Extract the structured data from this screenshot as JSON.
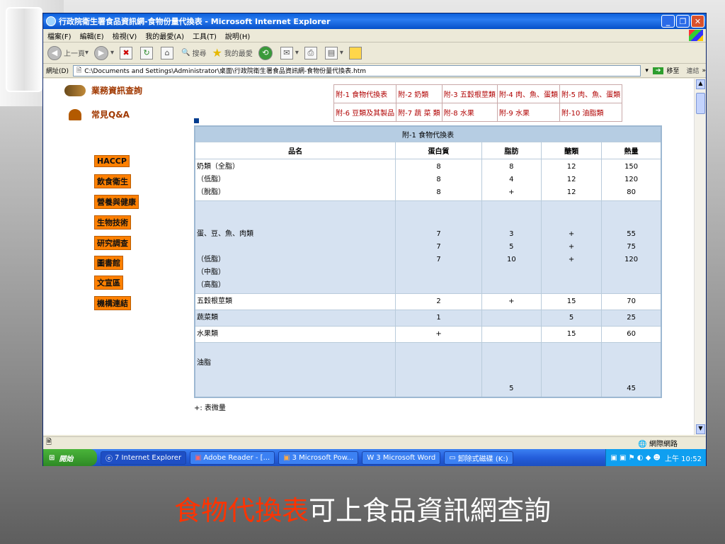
{
  "window": {
    "title": "行政院衛生署食品資訊網-食物份量代換表 - Microsoft Internet Explorer"
  },
  "menu": [
    "檔案(F)",
    "編輯(E)",
    "檢視(V)",
    "我的最愛(A)",
    "工具(T)",
    "說明(H)"
  ],
  "toolbar": {
    "back": "上一頁",
    "search": "搜尋",
    "favorites": "我的最愛"
  },
  "address": {
    "label": "網址(D)",
    "value": "C:\\Documents and Settings\\Administrator\\桌面\\行政院衛生署食品資訊網-食物份量代換表.htm",
    "go": "移至",
    "links": "連結"
  },
  "sidebar": {
    "main_items": [
      "業務資訊查詢",
      "常見Q&A"
    ],
    "menu_items": [
      "HACCP",
      "飲食衛生",
      "營養與健康",
      "生物技術",
      "研究調查",
      "圖書館",
      "文宣區",
      "機構連結"
    ]
  },
  "links": [
    [
      "附-1 食物代換表",
      "附-2 奶類",
      "附-3 五穀根莖類",
      "附-4 肉、魚、蛋類",
      "附-5 肉、魚、蛋類"
    ],
    [
      "附-6 豆類及其製品",
      "附-7 蔬 菜 類",
      "附-8 水果",
      "附-9 水果",
      "附-10 油脂類"
    ]
  ],
  "table": {
    "caption": "附-1 食物代換表",
    "headers": [
      "品名",
      "蛋白質",
      "脂肪",
      "醣類",
      "熱量"
    ],
    "rows": [
      {
        "name": [
          "奶類（全脂）",
          "（低脂）",
          "（脫脂）"
        ],
        "protein": [
          "8",
          "8",
          "8"
        ],
        "fat": [
          "8",
          "4",
          "+"
        ],
        "carb": [
          "12",
          "12",
          "12"
        ],
        "kcal": [
          "150",
          "120",
          "80"
        ]
      },
      {
        "name": [
          "",
          "",
          "蛋、豆、魚、肉類",
          "",
          "（低脂）",
          "（中脂）",
          "（高脂）"
        ],
        "protein": [
          "",
          "",
          "7",
          "7",
          "7",
          "",
          ""
        ],
        "fat": [
          "",
          "",
          "3",
          "5",
          "10",
          "",
          ""
        ],
        "carb": [
          "",
          "",
          "+",
          "+",
          "+",
          "",
          ""
        ],
        "kcal": [
          "",
          "",
          "55",
          "75",
          "120",
          "",
          ""
        ]
      },
      {
        "name": [
          "五穀根莖類"
        ],
        "protein": [
          "2"
        ],
        "fat": [
          "+"
        ],
        "carb": [
          "15"
        ],
        "kcal": [
          "70"
        ]
      },
      {
        "name": [
          "蔬菜類"
        ],
        "protein": [
          "1"
        ],
        "fat": [
          ""
        ],
        "carb": [
          "5"
        ],
        "kcal": [
          "25"
        ]
      },
      {
        "name": [
          "水果類"
        ],
        "protein": [
          "+"
        ],
        "fat": [
          ""
        ],
        "carb": [
          "15"
        ],
        "kcal": [
          "60"
        ]
      },
      {
        "name": [
          "",
          "油脂",
          "",
          ""
        ],
        "protein": [
          "",
          "",
          "",
          ""
        ],
        "fat": [
          "",
          "",
          "",
          "5"
        ],
        "carb": [
          "",
          "",
          "",
          ""
        ],
        "kcal": [
          "",
          "",
          "",
          "45"
        ]
      }
    ],
    "footnote": "+: 表微量"
  },
  "status": {
    "zone": "網際網路"
  },
  "taskbar": {
    "start": "開始",
    "tasks": [
      "7 Internet Explorer",
      "Adobe Reader - [...",
      "3 Microsoft Pow...",
      "3 Microsoft Word",
      "卸除式磁碟 (K:)"
    ],
    "clock": "上午 10:52"
  },
  "caption": {
    "red": "食物代換表",
    "white": "可上食品資訊網查詢"
  },
  "colors": {
    "accent_orange": "#ff8000",
    "link_red": "#b00000",
    "table_header": "#b6cde3",
    "caption_red": "#ff3300"
  }
}
